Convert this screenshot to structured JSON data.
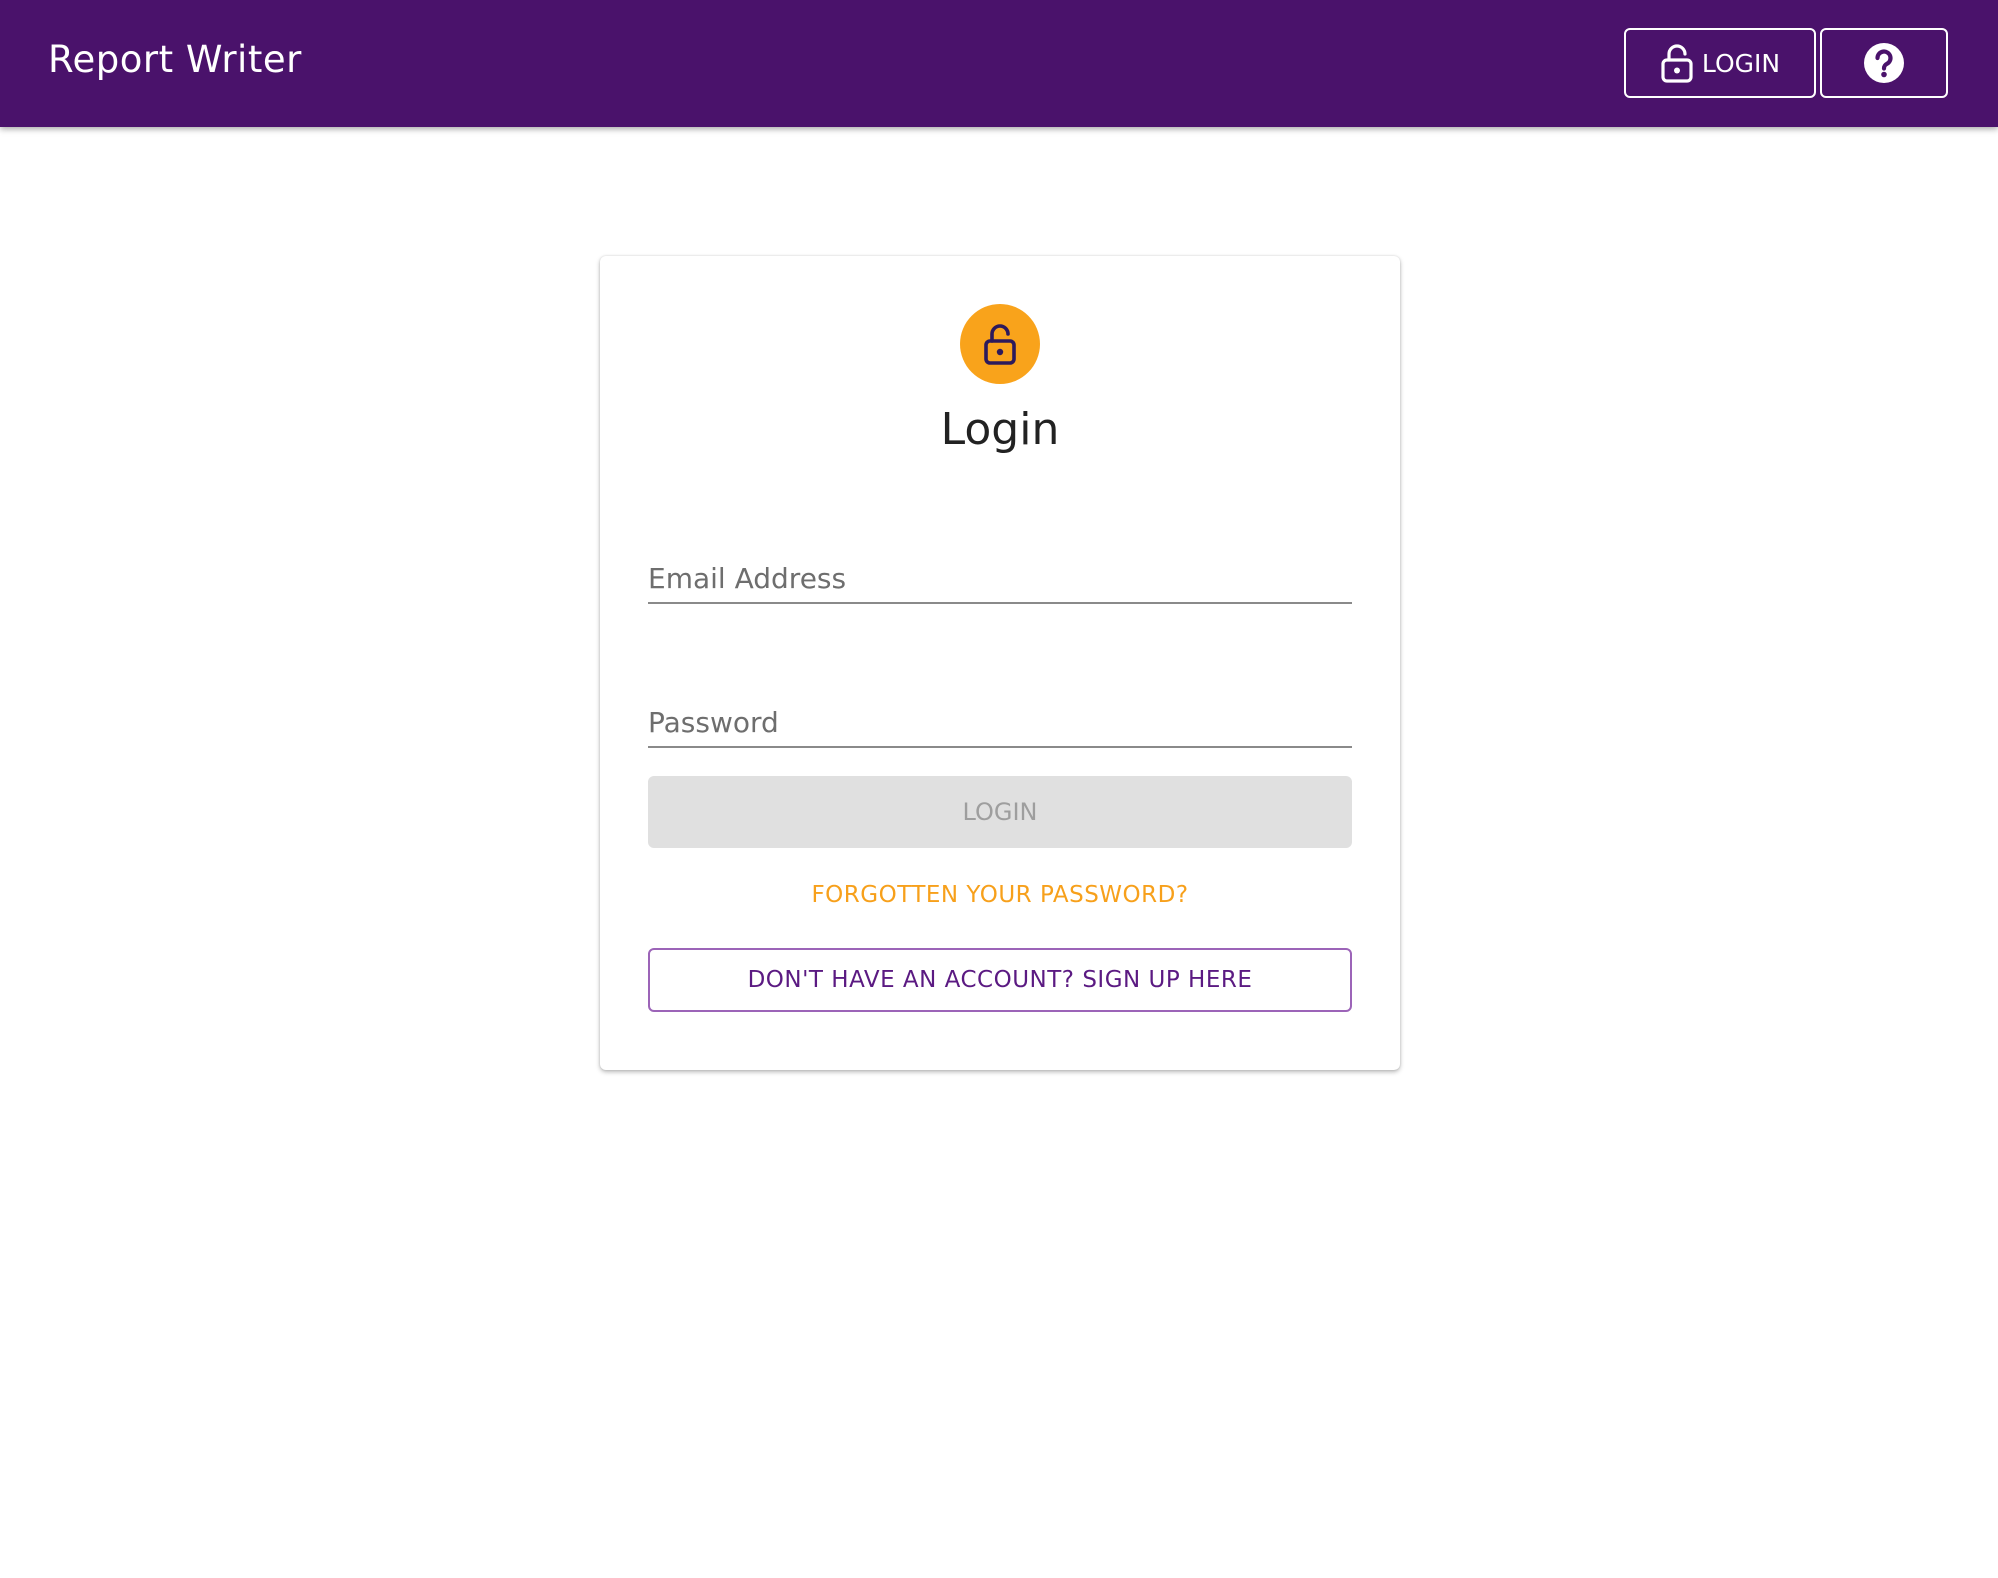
{
  "header": {
    "app_title": "Report Writer",
    "login_label": "LOGIN",
    "login_icon": "lock-open-icon",
    "help_icon": "help-circle-icon",
    "background_color": "#4a126b"
  },
  "login_card": {
    "avatar_icon": "lock-open-icon",
    "avatar_color": "#f9a31b",
    "title": "Login",
    "email": {
      "placeholder": "Email Address",
      "value": ""
    },
    "password": {
      "placeholder": "Password",
      "value": ""
    },
    "login_button_label": "LOGIN",
    "login_button_disabled": true,
    "forgot_link": "FORGOTTEN YOUR PASSWORD?",
    "signup_button_label": "DON'T HAVE AN ACCOUNT? SIGN UP HERE",
    "accent_color": "#f7a01b",
    "primary_color": "#5b1a82"
  }
}
